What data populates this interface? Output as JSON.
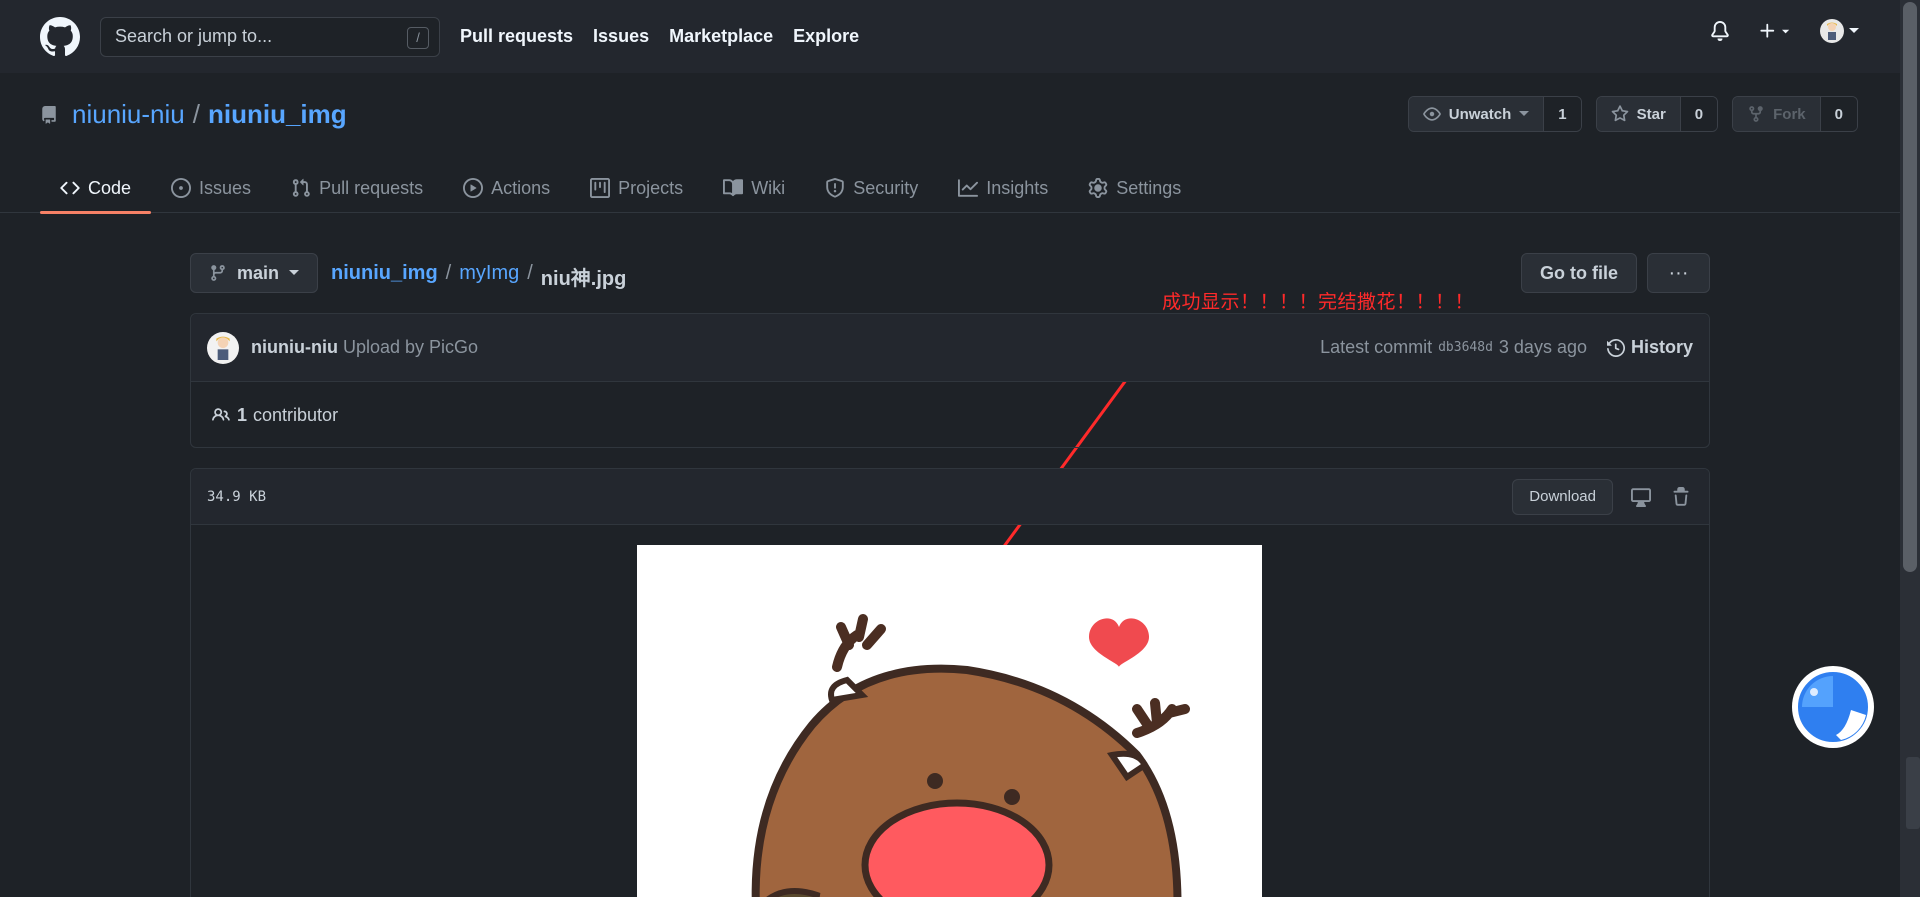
{
  "header": {
    "search_placeholder": "Search or jump to...",
    "search_shortcut": "/",
    "nav": [
      "Pull requests",
      "Issues",
      "Marketplace",
      "Explore"
    ]
  },
  "repo": {
    "owner": "niuniu-niu",
    "separator": "/",
    "name": "niuniu_img",
    "unwatch_label": "Unwatch",
    "watch_count": "1",
    "star_label": "Star",
    "star_count": "0",
    "fork_label": "Fork",
    "fork_count": "0"
  },
  "tabs": [
    {
      "label": "Code",
      "icon": "code-icon"
    },
    {
      "label": "Issues",
      "icon": "issue-icon"
    },
    {
      "label": "Pull requests",
      "icon": "pull-request-icon"
    },
    {
      "label": "Actions",
      "icon": "play-icon"
    },
    {
      "label": "Projects",
      "icon": "project-icon"
    },
    {
      "label": "Wiki",
      "icon": "book-icon"
    },
    {
      "label": "Security",
      "icon": "shield-icon"
    },
    {
      "label": "Insights",
      "icon": "graph-icon"
    },
    {
      "label": "Settings",
      "icon": "gear-icon"
    }
  ],
  "file": {
    "branch": "main",
    "path": [
      "niuniu_img",
      "myImg"
    ],
    "filename": "niu神.jpg",
    "goto_label": "Go to file",
    "more_label": "···",
    "size": "34.9 KB",
    "download_label": "Download"
  },
  "commit": {
    "author": "niuniu-niu",
    "message": "Upload by PicGo",
    "latest_label": "Latest commit",
    "sha": "db3648d",
    "time": "3 days ago",
    "history_label": "History",
    "contributors_count": "1",
    "contributors_label": "contributor"
  },
  "annotation": {
    "text": "成功显示！！！！完结撒花！！！！",
    "color": "#ff2a2a"
  },
  "colors": {
    "accent_link": "#58a6ff",
    "active_tab_underline": "#f78166",
    "background": "#1e2227"
  }
}
